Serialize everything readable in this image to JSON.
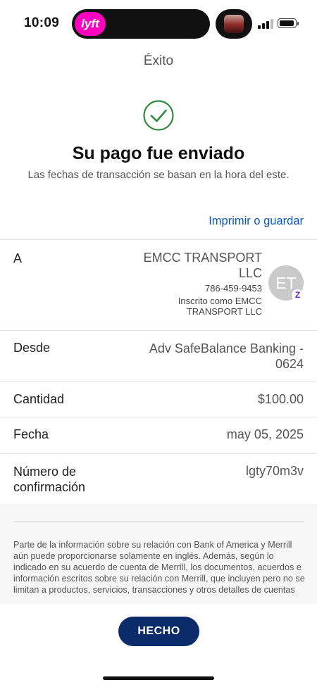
{
  "status_bar": {
    "time": "10:09",
    "lyft_label": "lyft"
  },
  "header": {
    "title": "Éxito"
  },
  "success": {
    "headline": "Su pago fue enviado",
    "subline": "Las fechas de transacción se basan en la hora del este.",
    "accent_color": "#2e8b3d"
  },
  "actions": {
    "print_label": "Imprimir o guardar"
  },
  "details": {
    "to": {
      "label": "A",
      "name": "EMCC TRANSPORT LLC",
      "phone": "786-459-9453",
      "enrolled": "Inscrito como EMCC TRANSPORT LLC",
      "avatar_initials": "ET",
      "badge_icon": "zelle-icon"
    },
    "from": {
      "label": "Desde",
      "value": "Adv SafeBalance Banking - 0624"
    },
    "amount": {
      "label": "Cantidad",
      "value": "$100.00"
    },
    "date": {
      "label": "Fecha",
      "value": "may 05, 2025"
    },
    "confirmation": {
      "label": "Número de confirmación",
      "value": "lgty70m3v"
    }
  },
  "disclaimer": {
    "text": "Parte de la información sobre su relación con Bank of America y Merrill aún puede proporcionarse solamente en inglés. Además, según lo indicado en su acuerdo de cuenta de Merrill, los documentos, acuerdos e información escritos sobre su relación con Merrill, que incluyen pero no se limitan a productos, servicios, transacciones y otros detalles de cuentas"
  },
  "footer": {
    "done_label": "HECHO",
    "button_color": "#0b2b6b"
  },
  "colors": {
    "link": "#0a59b8",
    "zelle": "#6d1ed4",
    "lyft": "#ff00bf"
  }
}
